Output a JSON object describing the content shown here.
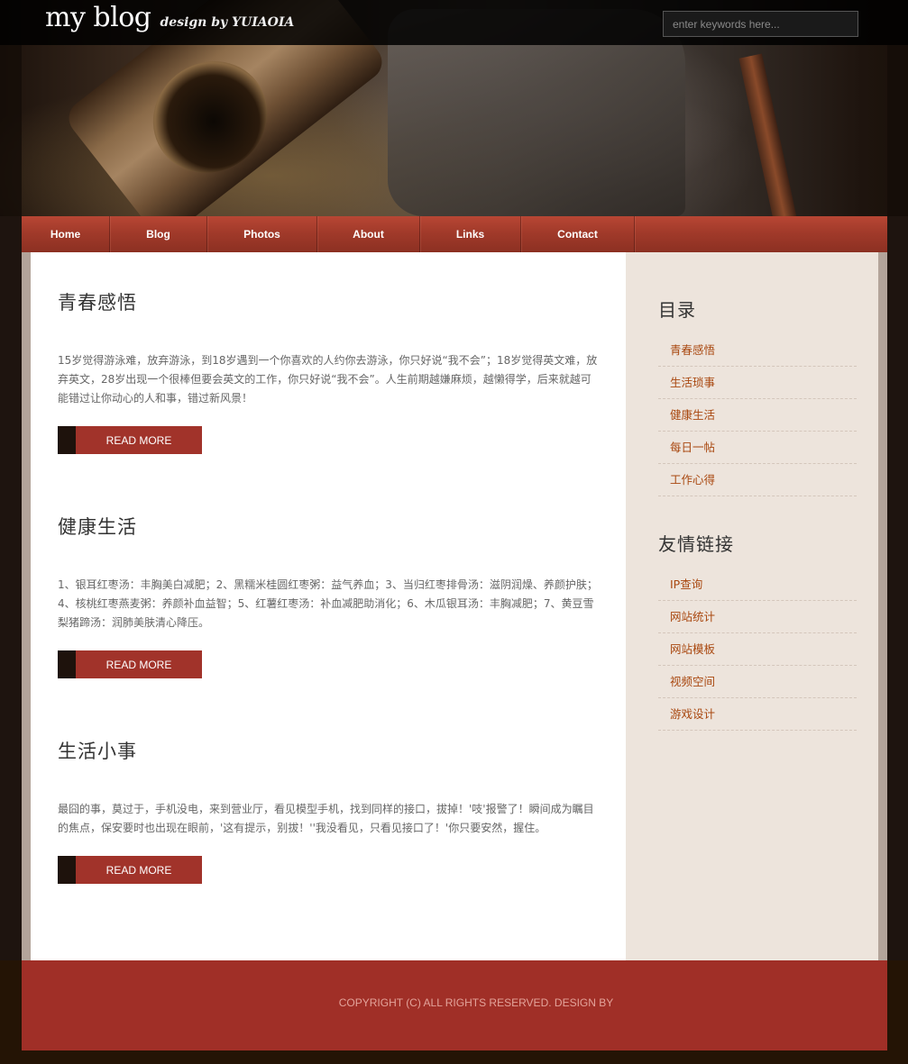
{
  "header": {
    "logo_main": "my blog",
    "logo_sub": "design by YUIAOIA",
    "search_placeholder": "enter keywords here..."
  },
  "nav": {
    "items": [
      "Home",
      "Blog",
      "Photos",
      "About",
      "Links",
      "Contact"
    ]
  },
  "posts": [
    {
      "title": "青春感悟",
      "body": "15岁觉得游泳难，放弃游泳，到18岁遇到一个你喜欢的人约你去游泳，你只好说“我不会”；18岁觉得英文难，放弃英文，28岁出现一个很棒但要会英文的工作，你只好说“我不会”。人生前期越嫌麻烦，越懒得学，后来就越可能错过让你动心的人和事，错过新风景！",
      "read_more": "READ MORE"
    },
    {
      "title": "健康生活",
      "body": "1、银耳红枣汤：丰胸美白减肥；2、黑糯米桂圆红枣粥：益气养血；3、当归红枣排骨汤：滋阴润燥、养颜护肤；4、核桃红枣燕麦粥：养颜补血益智；5、红薯红枣汤：补血减肥助消化；6、木瓜银耳汤：丰胸减肥；7、黄豆雪梨猪蹄汤：润肺美肤清心降压。",
      "read_more": "READ MORE"
    },
    {
      "title": "生活小事",
      "body": "最囧的事，莫过于，手机没电，来到营业厅，看见模型手机，找到同样的接口，拔掉！'吱'报警了！瞬间成为瞩目的焦点，保安要时也出现在眼前，'这有提示，别拔！''我没看见，只看见接口了！'你只要安然，握住。",
      "read_more": "READ MORE"
    }
  ],
  "sidebar": {
    "catalog_title": "目录",
    "catalog_items": [
      "青春感悟",
      "生活琐事",
      "健康生活",
      "每日一帖",
      "工作心得"
    ],
    "links_title": "友情链接",
    "links_items": [
      "IP查询",
      "网站统计",
      "网站模板",
      "视频空间",
      "游戏设计"
    ]
  },
  "footer": {
    "copyright": "COPYRIGHT (C) ALL RIGHTS RESERVED. DESIGN BY"
  },
  "colors": {
    "accent_red": "#a1332a",
    "nav_red": "#a13a2a",
    "sidebar_bg": "#ede4dc",
    "link_orange": "#a94810"
  }
}
